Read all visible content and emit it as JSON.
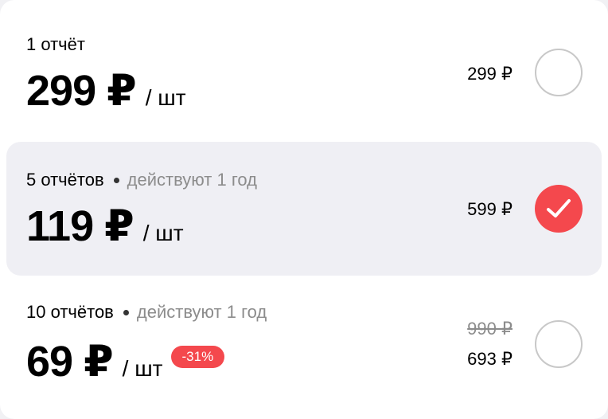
{
  "options": [
    {
      "title": "1 отчёт",
      "validity": "",
      "price": "299 ₽",
      "unit": "/ шт",
      "old_total": "",
      "total": "299 ₽",
      "discount": "",
      "selected": false
    },
    {
      "title": "5 отчётов",
      "validity": "действуют 1 год",
      "price": "119 ₽",
      "unit": "/ шт",
      "old_total": "",
      "total": "599 ₽",
      "discount": "",
      "selected": true
    },
    {
      "title": "10 отчётов",
      "validity": "действуют 1 год",
      "price": "69 ₽",
      "unit": "/ шт",
      "old_total": "990 ₽",
      "total": "693 ₽",
      "discount": "-31%",
      "selected": false
    }
  ],
  "colors": {
    "accent": "#f4484d",
    "selected_bg": "#efeff4",
    "muted_text": "#8c8c8c"
  },
  "icons": {
    "checked": "checkmark-icon"
  }
}
